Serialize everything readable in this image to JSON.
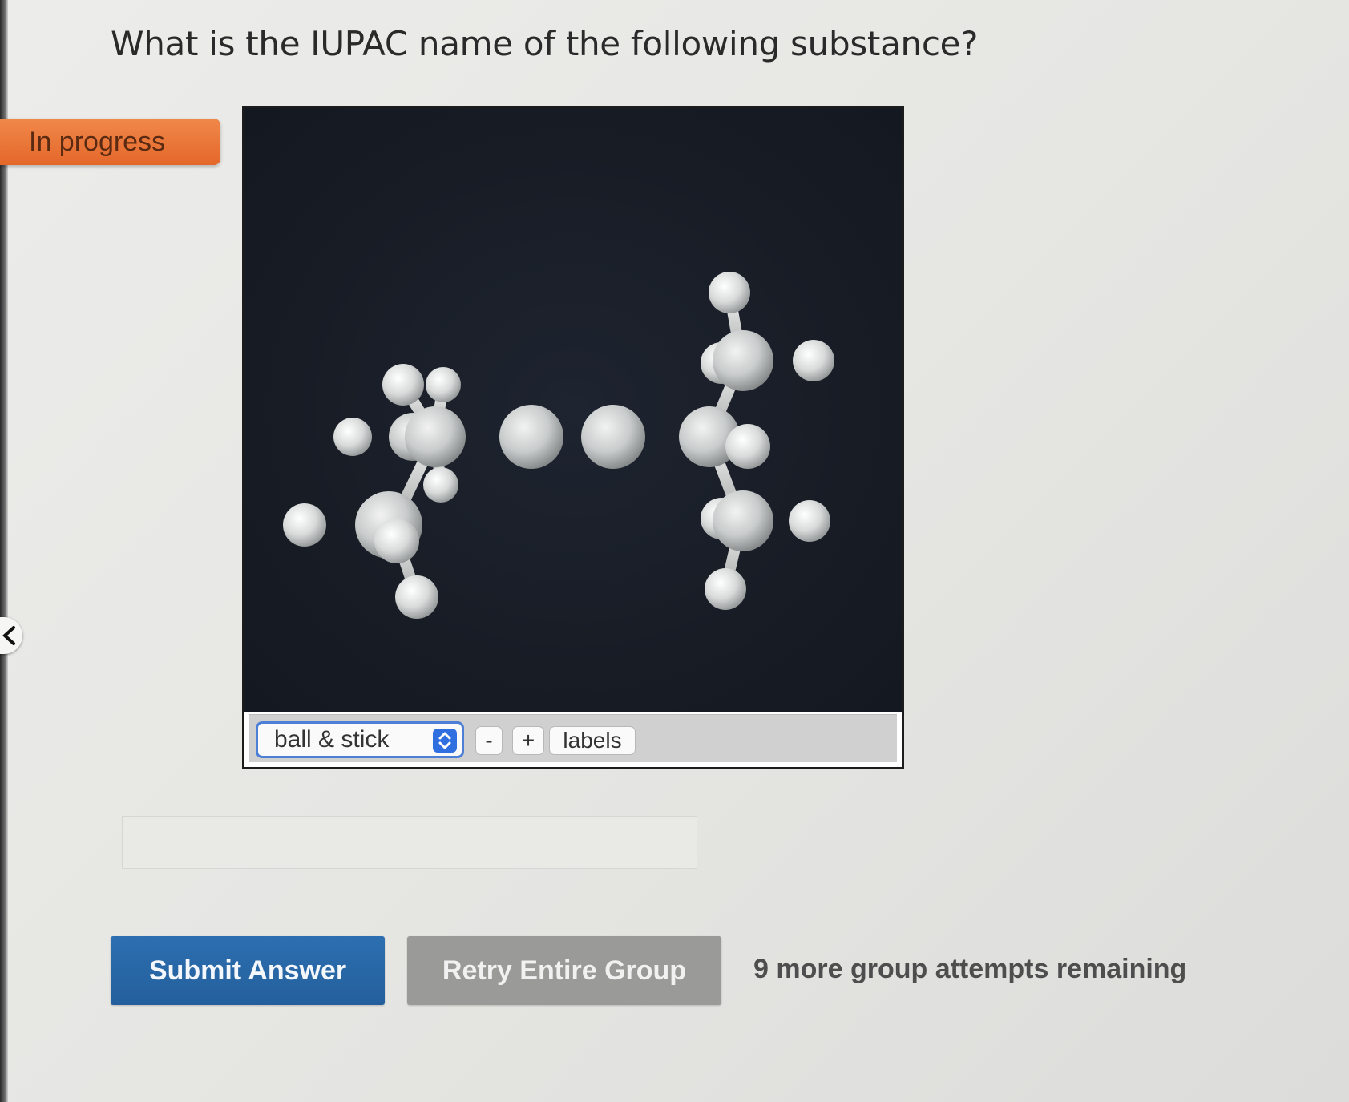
{
  "question": {
    "text": "What is the IUPAC name of the following substance?"
  },
  "status": {
    "label": "In progress",
    "color": "#e8702f"
  },
  "viewer": {
    "background": "#161b23",
    "atom_color": "#d9dcdc",
    "toolbar": {
      "style_select_value": "ball & stick",
      "zoom_out_label": "-",
      "zoom_in_label": "+",
      "labels_label": "labels"
    }
  },
  "answer": {
    "value": ""
  },
  "buttons": {
    "submit_label": "Submit Answer",
    "submit_color": "#2a69a9",
    "retry_label": "Retry Entire Group",
    "retry_color": "#9a9a98"
  },
  "attempts_text": "9 more group attempts remaining"
}
